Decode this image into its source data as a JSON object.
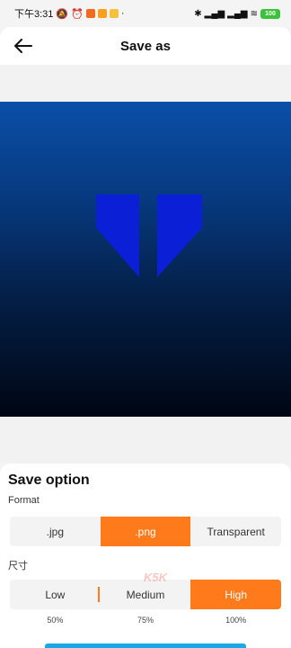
{
  "status_bar": {
    "time": "下午3:31",
    "battery": "100"
  },
  "header": {
    "title": "Save as",
    "back_icon": "arrow-left-icon"
  },
  "options": {
    "title": "Save option",
    "format_label": "Format",
    "formats": [
      ".jpg",
      ".png",
      "Transparent"
    ],
    "selected_format": ".png",
    "size_label": "尺寸",
    "sizes": [
      "Low",
      "Medium",
      "High"
    ],
    "size_percents": [
      "50%",
      "75%",
      "100%"
    ],
    "selected_size": "High"
  },
  "colors": {
    "accent": "#ff7a1a",
    "preview_top": "#0a4fa8",
    "preview_bottom": "#000613",
    "logo_blue": "#0a1fd6"
  },
  "watermark": "K5K"
}
